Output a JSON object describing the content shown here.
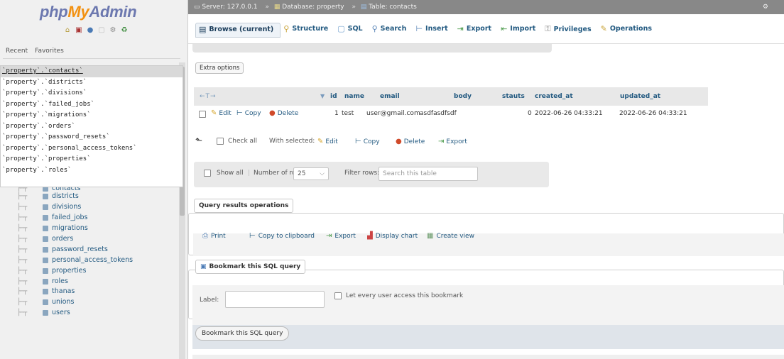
{
  "sidebar": {
    "logo": {
      "php": "php",
      "my": "My",
      "admin": "Admin"
    },
    "tabs": [
      "Recent",
      "Favorites"
    ],
    "recent": [
      "`property`.`contacts`",
      "`property`.`districts`",
      "`property`.`divisions`",
      "`property`.`failed_jobs`",
      "`property`.`migrations`",
      "`property`.`orders`",
      "`property`.`password_resets`",
      "`property`.`personal_access_tokens`",
      "`property`.`properties`",
      "`property`.`roles`"
    ],
    "tree": [
      "contacts",
      "districts",
      "divisions",
      "failed_jobs",
      "migrations",
      "orders",
      "password_resets",
      "personal_access_tokens",
      "properties",
      "roles",
      "thanas",
      "unions",
      "users"
    ]
  },
  "topbar": {
    "server": "Server: 127.0.0.1",
    "database": "Database: property",
    "table": "Table: contacts"
  },
  "tabs": [
    {
      "label": "Browse (current)",
      "icon": "▤"
    },
    {
      "label": "Structure",
      "icon": "⚲"
    },
    {
      "label": "SQL",
      "icon": "▢"
    },
    {
      "label": "Search",
      "icon": "⚲"
    },
    {
      "label": "Insert",
      "icon": "⊢"
    },
    {
      "label": "Export",
      "icon": "⇥"
    },
    {
      "label": "Import",
      "icon": "⇤"
    },
    {
      "label": "Privileges",
      "icon": "⚿"
    },
    {
      "label": "Operations",
      "icon": "✎"
    }
  ],
  "main": {
    "extra_options": "Extra options",
    "arrows": "←T→",
    "sort_icon": "▼",
    "columns": [
      "id",
      "name",
      "email",
      "body",
      "stauts",
      "created_at",
      "updated_at"
    ],
    "row": {
      "edit": "Edit",
      "copy": "Copy",
      "delete": "Delete",
      "values": [
        "1",
        "test",
        "user@gmail.com",
        "asdfasdfsdf",
        "0",
        "2022-06-26 04:33:21",
        "2022-06-26 04:33:21"
      ]
    },
    "with_selected": {
      "check_all": "Check all",
      "label": "With selected:",
      "edit": "Edit",
      "copy": "Copy",
      "delete": "Delete",
      "export": "Export"
    },
    "rows_panel": {
      "show_all": "Show all",
      "number_of_rows": "Number of rows:",
      "rows_value": "25",
      "filter_rows": "Filter rows:",
      "filter_placeholder": "Search this table"
    },
    "query_ops": {
      "legend": "Query results operations",
      "print": "Print",
      "copy": "Copy to clipboard",
      "export": "Export",
      "chart": "Display chart",
      "view": "Create view"
    },
    "bookmark": {
      "legend": "Bookmark this SQL query",
      "label": "Label:",
      "share": "Let every user access this bookmark",
      "submit": "Bookmark this SQL query"
    }
  }
}
